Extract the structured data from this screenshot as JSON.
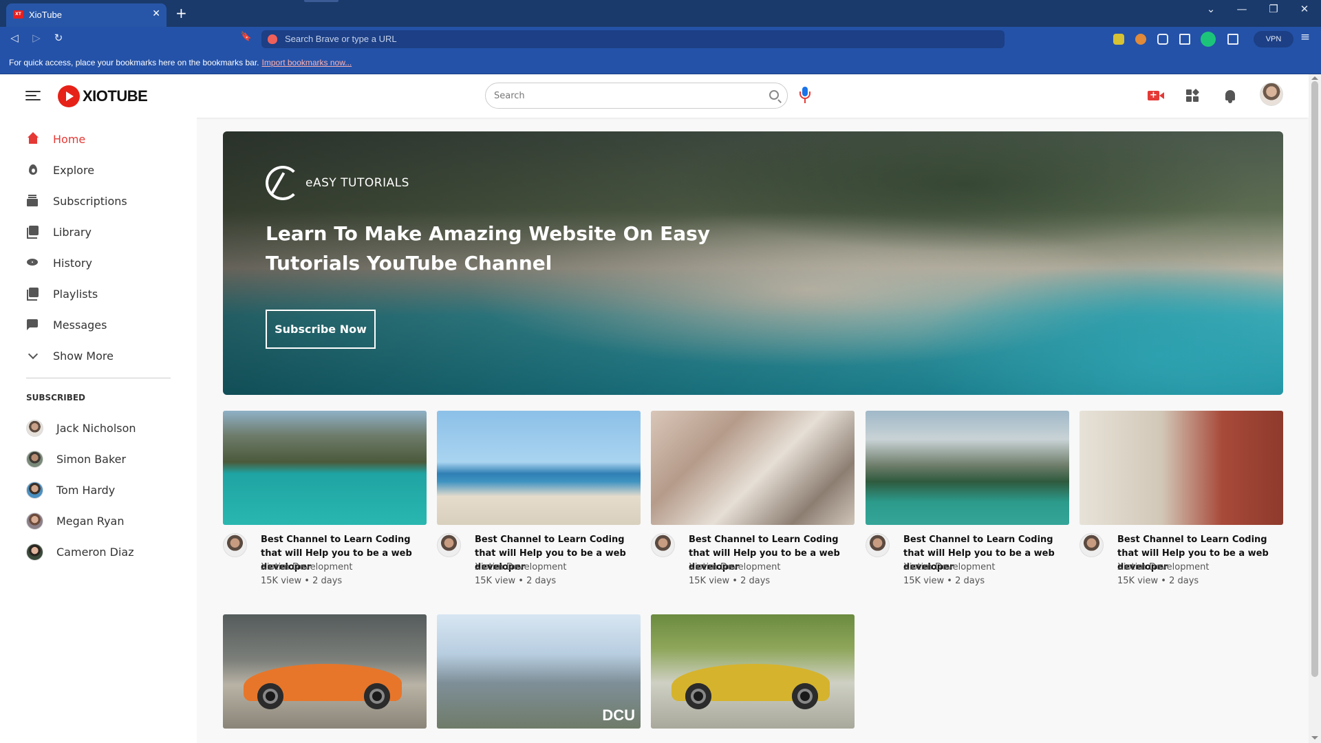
{
  "browser": {
    "tab_title": "XioTube",
    "tab_favicon_text": "XT",
    "tab_close": "✕",
    "new_tab": "+",
    "omnibox_placeholder": "Search Brave or type a URL",
    "vpn_label": "VPN",
    "bookmarks_hint": "For quick access, place your bookmarks here on the bookmarks bar.",
    "bookmarks_link": "Import bookmarks now...",
    "window_controls": {
      "dropdown": "⌄",
      "minimize": "—",
      "restore": "❐",
      "close": "✕"
    },
    "nav": {
      "back": "◁",
      "forward": "▷",
      "reload": "↻",
      "bookmark": "🔖",
      "menu": "≡"
    }
  },
  "site": {
    "logo_text": "XIOTUBE",
    "search_placeholder": "Search",
    "brand_color": "#e53935"
  },
  "sidebar": {
    "items": [
      {
        "label": "Home",
        "icon": "home-icon",
        "active": true
      },
      {
        "label": "Explore",
        "icon": "explore-icon"
      },
      {
        "label": "Subscriptions",
        "icon": "subscriptions-icon"
      },
      {
        "label": "Library",
        "icon": "library-icon"
      },
      {
        "label": "History",
        "icon": "history-icon"
      },
      {
        "label": "Playlists",
        "icon": "playlists-icon"
      },
      {
        "label": "Messages",
        "icon": "messages-icon"
      },
      {
        "label": "Show More",
        "icon": "chevron-down-icon"
      }
    ],
    "subscribed_heading": "SUBSCRIBED",
    "subscribed": [
      {
        "name": "Jack Nicholson"
      },
      {
        "name": "Simon Baker"
      },
      {
        "name": "Tom Hardy"
      },
      {
        "name": "Megan Ryan"
      },
      {
        "name": "Cameron Diaz"
      }
    ]
  },
  "banner": {
    "brand": "eASY TUTORIALS",
    "title": "Learn To Make Amazing Website On Easy Tutorials YouTube Channel",
    "button": "Subscribe Now"
  },
  "videos": [
    {
      "title": "Best Channel to Learn Coding that will Help you to be a web developer",
      "channel": "Xiotim Development",
      "stats": "15K view • 2 days"
    },
    {
      "title": "Best Channel to Learn Coding that will Help you to be a web developer",
      "channel": "Xiotim Development",
      "stats": "15K view • 2 days"
    },
    {
      "title": "Best Channel to Learn Coding that will Help you to be a web developer",
      "channel": "Xiotim Development",
      "stats": "15K view • 2 days"
    },
    {
      "title": "Best Channel to Learn Coding that will Help you to be a web developer",
      "channel": "Xiotim Development",
      "stats": "15K view • 2 days"
    },
    {
      "title": "Best Channel to Learn Coding that will Help you to be a web developer",
      "channel": "Xiotim Development",
      "stats": "15K view • 2 days"
    }
  ],
  "thumb_overlay": {
    "dcu": "DCU"
  }
}
